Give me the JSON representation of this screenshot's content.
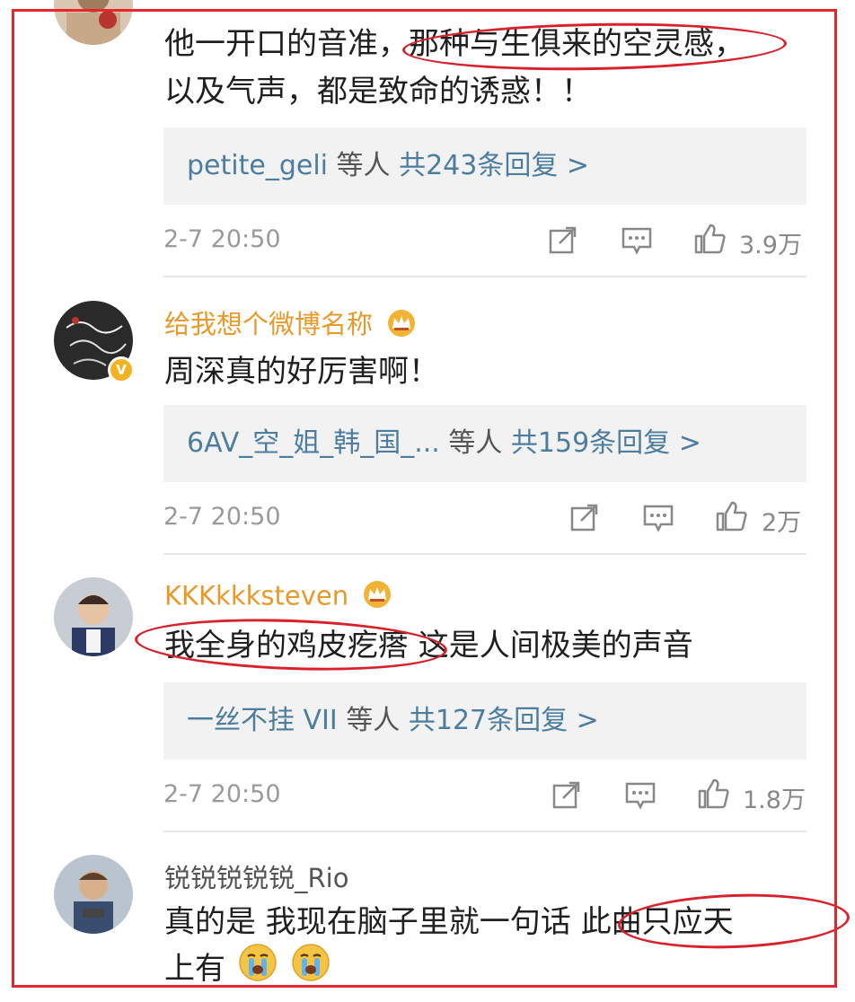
{
  "comments": [
    {
      "username": "",
      "text_lines": [
        "他一开口的音准，那种与生俱来的空灵感，",
        "以及气声，都是致命的诱惑！！"
      ],
      "replies": {
        "who": "petite_geli",
        "etc": "等人",
        "count": "共243条回复 >"
      },
      "time": "2-7 20:50",
      "likes": "3.9万"
    },
    {
      "username": "给我想个微博名称",
      "text_lines": [
        "周深真的好厉害啊！"
      ],
      "replies": {
        "who": "6AV_空_姐_韩_国_...",
        "etc": "等人",
        "count": "共159条回复 >"
      },
      "time": "2-7 20:50",
      "likes": "2万"
    },
    {
      "username": "KKKkkksteven",
      "text_lines": [
        "我全身的鸡皮疙瘩 这是人间极美的声音"
      ],
      "replies": {
        "who": "一丝不挂 VII",
        "etc": "等人",
        "count": "共127条回复 >"
      },
      "time": "2-7 20:50",
      "likes": "1.8万"
    },
    {
      "username": "锐锐锐锐锐_Rio",
      "text_lines": [
        "真的是  我现在脑子里就一句话 此曲只应天",
        "上有"
      ]
    }
  ],
  "icons": {
    "share": "share-icon",
    "comment": "comment-icon",
    "like": "thumbs-up-icon",
    "crown": "crown-icon",
    "crying": "crying-emoji-icon"
  },
  "colors": {
    "username_gold": "#e79a2a",
    "reply_link": "#4d7d9e",
    "annotation_red": "#e6262c",
    "reply_bg": "#f2f2f2"
  }
}
